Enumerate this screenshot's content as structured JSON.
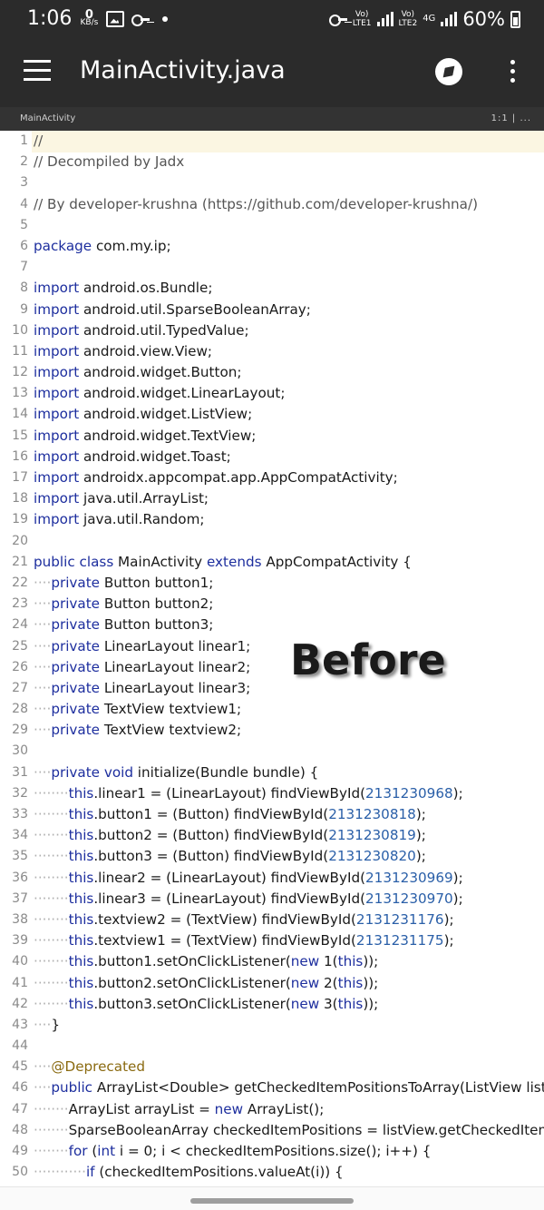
{
  "status_bar": {
    "time": "1:06",
    "net_speed_value": "0",
    "net_speed_unit": "KB/s",
    "vol1": "Vo)",
    "lte1": "LTE1",
    "vol2": "Vo)",
    "lte2": "LTE2",
    "net_type": "4G",
    "battery": "60%",
    "battery_level": 0.6
  },
  "app_bar": {
    "title": "MainActivity.java",
    "menu_icon": "hamburger-icon",
    "compass_icon": "compass-icon",
    "overflow_icon": "more-vert-icon"
  },
  "tab": {
    "file": "MainActivity",
    "position": "1:1 | ..."
  },
  "watermark": "Before",
  "code_lines": [
    {
      "n": "1",
      "ind": "",
      "segs": [
        {
          "t": "//",
          "c": "cm"
        }
      ]
    },
    {
      "n": "2",
      "ind": "",
      "segs": [
        {
          "t": "// Decompiled by Jadx",
          "c": "cm"
        }
      ]
    },
    {
      "n": "3",
      "ind": "",
      "segs": []
    },
    {
      "n": "4",
      "ind": "",
      "segs": [
        {
          "t": "// By developer-krushna (https://github.com/developer-krushna/)",
          "c": "cm"
        }
      ]
    },
    {
      "n": "5",
      "ind": "",
      "segs": []
    },
    {
      "n": "6",
      "ind": "",
      "segs": [
        {
          "t": "package",
          "c": "kw"
        },
        {
          "t": " com.my.ip;"
        }
      ]
    },
    {
      "n": "7",
      "ind": "",
      "segs": []
    },
    {
      "n": "8",
      "ind": "",
      "segs": [
        {
          "t": "import",
          "c": "kw"
        },
        {
          "t": " android.os.Bundle;"
        }
      ]
    },
    {
      "n": "9",
      "ind": "",
      "segs": [
        {
          "t": "import",
          "c": "kw"
        },
        {
          "t": " android.util.SparseBooleanArray;"
        }
      ]
    },
    {
      "n": "10",
      "ind": "",
      "segs": [
        {
          "t": "import",
          "c": "kw"
        },
        {
          "t": " android.util.TypedValue;"
        }
      ]
    },
    {
      "n": "11",
      "ind": "",
      "segs": [
        {
          "t": "import",
          "c": "kw"
        },
        {
          "t": " android.view.View;"
        }
      ]
    },
    {
      "n": "12",
      "ind": "",
      "segs": [
        {
          "t": "import",
          "c": "kw"
        },
        {
          "t": " android.widget.Button;"
        }
      ]
    },
    {
      "n": "13",
      "ind": "",
      "segs": [
        {
          "t": "import",
          "c": "kw"
        },
        {
          "t": " android.widget.LinearLayout;"
        }
      ]
    },
    {
      "n": "14",
      "ind": "",
      "segs": [
        {
          "t": "import",
          "c": "kw"
        },
        {
          "t": " android.widget.ListView;"
        }
      ]
    },
    {
      "n": "15",
      "ind": "",
      "segs": [
        {
          "t": "import",
          "c": "kw"
        },
        {
          "t": " android.widget.TextView;"
        }
      ]
    },
    {
      "n": "16",
      "ind": "",
      "segs": [
        {
          "t": "import",
          "c": "kw"
        },
        {
          "t": " android.widget.Toast;"
        }
      ]
    },
    {
      "n": "17",
      "ind": "",
      "segs": [
        {
          "t": "import",
          "c": "kw"
        },
        {
          "t": " androidx.appcompat.app.AppCompatActivity;"
        }
      ]
    },
    {
      "n": "18",
      "ind": "",
      "segs": [
        {
          "t": "import",
          "c": "kw"
        },
        {
          "t": " java.util.ArrayList;"
        }
      ]
    },
    {
      "n": "19",
      "ind": "",
      "segs": [
        {
          "t": "import",
          "c": "kw"
        },
        {
          "t": " java.util.Random;"
        }
      ]
    },
    {
      "n": "20",
      "ind": "",
      "segs": []
    },
    {
      "n": "21",
      "ind": "",
      "segs": [
        {
          "t": "public class",
          "c": "kw"
        },
        {
          "t": " MainActivity "
        },
        {
          "t": "extends",
          "c": "kw"
        },
        {
          "t": " AppCompatActivity {"
        }
      ]
    },
    {
      "n": "22",
      "ind": "····",
      "segs": [
        {
          "t": "private",
          "c": "kw"
        },
        {
          "t": " Button button1;"
        }
      ]
    },
    {
      "n": "23",
      "ind": "····",
      "segs": [
        {
          "t": "private",
          "c": "kw"
        },
        {
          "t": " Button button2;"
        }
      ]
    },
    {
      "n": "24",
      "ind": "····",
      "segs": [
        {
          "t": "private",
          "c": "kw"
        },
        {
          "t": " Button button3;"
        }
      ]
    },
    {
      "n": "25",
      "ind": "····",
      "segs": [
        {
          "t": "private",
          "c": "kw"
        },
        {
          "t": " LinearLayout linear1;"
        }
      ]
    },
    {
      "n": "26",
      "ind": "····",
      "segs": [
        {
          "t": "private",
          "c": "kw"
        },
        {
          "t": " LinearLayout linear2;"
        }
      ]
    },
    {
      "n": "27",
      "ind": "····",
      "segs": [
        {
          "t": "private",
          "c": "kw"
        },
        {
          "t": " LinearLayout linear3;"
        }
      ]
    },
    {
      "n": "28",
      "ind": "····",
      "segs": [
        {
          "t": "private",
          "c": "kw"
        },
        {
          "t": " TextView textview1;"
        }
      ]
    },
    {
      "n": "29",
      "ind": "····",
      "segs": [
        {
          "t": "private",
          "c": "kw"
        },
        {
          "t": " TextView textview2;"
        }
      ]
    },
    {
      "n": "30",
      "ind": "",
      "segs": []
    },
    {
      "n": "31",
      "ind": "····",
      "segs": [
        {
          "t": "private void",
          "c": "kw"
        },
        {
          "t": " initialize(Bundle bundle) {"
        }
      ]
    },
    {
      "n": "32",
      "ind": "········",
      "segs": [
        {
          "t": "this",
          "c": "kw"
        },
        {
          "t": ".linear1 = (LinearLayout) findViewById("
        },
        {
          "t": "2131230968",
          "c": "num"
        },
        {
          "t": ");"
        }
      ]
    },
    {
      "n": "33",
      "ind": "········",
      "segs": [
        {
          "t": "this",
          "c": "kw"
        },
        {
          "t": ".button1 = (Button) findViewById("
        },
        {
          "t": "2131230818",
          "c": "num"
        },
        {
          "t": ");"
        }
      ]
    },
    {
      "n": "34",
      "ind": "········",
      "segs": [
        {
          "t": "this",
          "c": "kw"
        },
        {
          "t": ".button2 = (Button) findViewById("
        },
        {
          "t": "2131230819",
          "c": "num"
        },
        {
          "t": ");"
        }
      ]
    },
    {
      "n": "35",
      "ind": "········",
      "segs": [
        {
          "t": "this",
          "c": "kw"
        },
        {
          "t": ".button3 = (Button) findViewById("
        },
        {
          "t": "2131230820",
          "c": "num"
        },
        {
          "t": ");"
        }
      ]
    },
    {
      "n": "36",
      "ind": "········",
      "segs": [
        {
          "t": "this",
          "c": "kw"
        },
        {
          "t": ".linear2 = (LinearLayout) findViewById("
        },
        {
          "t": "2131230969",
          "c": "num"
        },
        {
          "t": ");"
        }
      ]
    },
    {
      "n": "37",
      "ind": "········",
      "segs": [
        {
          "t": "this",
          "c": "kw"
        },
        {
          "t": ".linear3 = (LinearLayout) findViewById("
        },
        {
          "t": "2131230970",
          "c": "num"
        },
        {
          "t": ");"
        }
      ]
    },
    {
      "n": "38",
      "ind": "········",
      "segs": [
        {
          "t": "this",
          "c": "kw"
        },
        {
          "t": ".textview2 = (TextView) findViewById("
        },
        {
          "t": "2131231176",
          "c": "num"
        },
        {
          "t": ");"
        }
      ]
    },
    {
      "n": "39",
      "ind": "········",
      "segs": [
        {
          "t": "this",
          "c": "kw"
        },
        {
          "t": ".textview1 = (TextView) findViewById("
        },
        {
          "t": "2131231175",
          "c": "num"
        },
        {
          "t": ");"
        }
      ]
    },
    {
      "n": "40",
      "ind": "········",
      "segs": [
        {
          "t": "this",
          "c": "kw"
        },
        {
          "t": ".button1.setOnClickListener("
        },
        {
          "t": "new",
          "c": "kw"
        },
        {
          "t": " 1("
        },
        {
          "t": "this",
          "c": "kw"
        },
        {
          "t": "));"
        }
      ]
    },
    {
      "n": "41",
      "ind": "········",
      "segs": [
        {
          "t": "this",
          "c": "kw"
        },
        {
          "t": ".button2.setOnClickListener("
        },
        {
          "t": "new",
          "c": "kw"
        },
        {
          "t": " 2("
        },
        {
          "t": "this",
          "c": "kw"
        },
        {
          "t": "));"
        }
      ]
    },
    {
      "n": "42",
      "ind": "········",
      "segs": [
        {
          "t": "this",
          "c": "kw"
        },
        {
          "t": ".button3.setOnClickListener("
        },
        {
          "t": "new",
          "c": "kw"
        },
        {
          "t": " 3("
        },
        {
          "t": "this",
          "c": "kw"
        },
        {
          "t": "));"
        }
      ]
    },
    {
      "n": "43",
      "ind": "····",
      "segs": [
        {
          "t": "}"
        }
      ]
    },
    {
      "n": "44",
      "ind": "",
      "segs": []
    },
    {
      "n": "45",
      "ind": "····",
      "segs": [
        {
          "t": "@Deprecated",
          "c": "an"
        }
      ]
    },
    {
      "n": "46",
      "ind": "····",
      "segs": [
        {
          "t": "public",
          "c": "kw"
        },
        {
          "t": " ArrayList<Double> getCheckedItemPositionsToArray(ListView listView) {"
        }
      ]
    },
    {
      "n": "47",
      "ind": "········",
      "segs": [
        {
          "t": "ArrayList arrayList = "
        },
        {
          "t": "new",
          "c": "kw"
        },
        {
          "t": " ArrayList();"
        }
      ]
    },
    {
      "n": "48",
      "ind": "········",
      "segs": [
        {
          "t": "SparseBooleanArray checkedItemPositions = listView.getCheckedItemPositions();"
        }
      ]
    },
    {
      "n": "49",
      "ind": "········",
      "segs": [
        {
          "t": "for",
          "c": "kw"
        },
        {
          "t": " ("
        },
        {
          "t": "int",
          "c": "kw"
        },
        {
          "t": " i = 0; i < checkedItemPositions.size(); i++) {"
        }
      ]
    },
    {
      "n": "50",
      "ind": "············",
      "segs": [
        {
          "t": "if",
          "c": "kw"
        },
        {
          "t": " (checkedItemPositions.valueAt(i)) {"
        }
      ]
    }
  ]
}
